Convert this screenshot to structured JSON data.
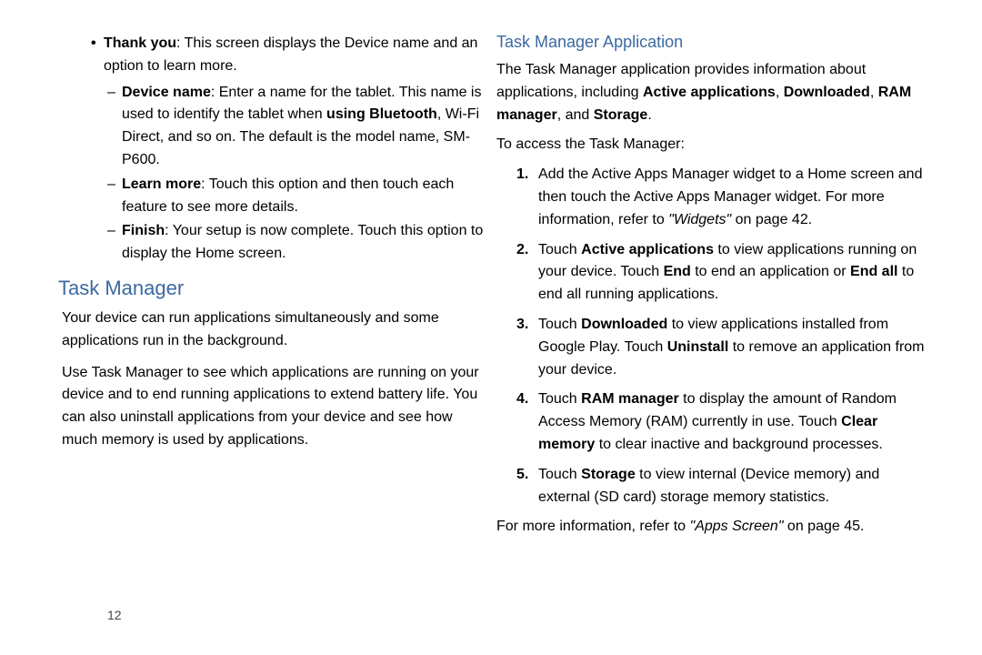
{
  "left": {
    "thankyou_label": "Thank you",
    "thankyou_text": ": This screen displays the Device name and an option to learn more.",
    "sub": [
      {
        "label": "Device name",
        "text_before_bold2": ": Enter a name for the tablet. This name is used to identify the tablet when",
        "bold2": "using Bluetooth",
        "text_after": ", Wi-Fi Direct, and so on. The default is the model name, SM-P600."
      },
      {
        "label": "Learn more",
        "text": ": Touch this option and then touch each feature to see more details."
      },
      {
        "label": "Finish",
        "text": ": Your setup is now complete. Touch this option to display the Home screen."
      }
    ],
    "heading": "Task Manager",
    "p1": "Your device can run applications simultaneously and some applications run in the background.",
    "p2": "Use Task Manager to see which applications are running on your device and to end running applications to extend battery life. You can also uninstall applications from your device and see how much memory is used by applications."
  },
  "right": {
    "heading": "Task Manager Application",
    "intro_pre": "The Task Manager application provides information about applications, including ",
    "b1": "Active applications",
    "comma1": ", ",
    "b2": "Downloaded",
    "comma2": ", ",
    "b3": "RAM manager",
    "and": ", and ",
    "b4": "Storage",
    "period": ".",
    "access_label": "To access the Task Manager:",
    "steps": [
      {
        "n": "1.",
        "pre": "Add the Active Apps Manager widget to a Home screen and then touch the Active Apps Manager widget. For more information, refer to ",
        "ref": "\"Widgets\"",
        "post": " on page 42."
      },
      {
        "n": "2.",
        "pre": "Touch ",
        "b_a": "Active applications",
        "mid_a": " to view applications running on your device. Touch ",
        "b_b": "End",
        "mid_b": " to end an application or ",
        "b_c": "End all",
        "post": " to end all running applications."
      },
      {
        "n": "3.",
        "pre": "Touch ",
        "b_a": "Downloaded",
        "mid_a": " to view applications installed from Google Play. Touch ",
        "b_b": "Uninstall",
        "post": " to remove an application from your device."
      },
      {
        "n": "4.",
        "pre": "Touch ",
        "b_a": "RAM manager",
        "mid_a": " to display the amount of Random Access Memory (RAM) currently in use. Touch ",
        "b_b": "Clear memory",
        "post": " to clear inactive and background processes."
      },
      {
        "n": "5.",
        "pre": "Touch ",
        "b_a": "Storage",
        "post": " to view internal (Device memory) and external (SD card) storage memory statistics."
      }
    ],
    "more_pre": "For more information, refer to ",
    "more_ref": "\"Apps Screen\"",
    "more_post": " on page 45."
  },
  "page_number": "12"
}
